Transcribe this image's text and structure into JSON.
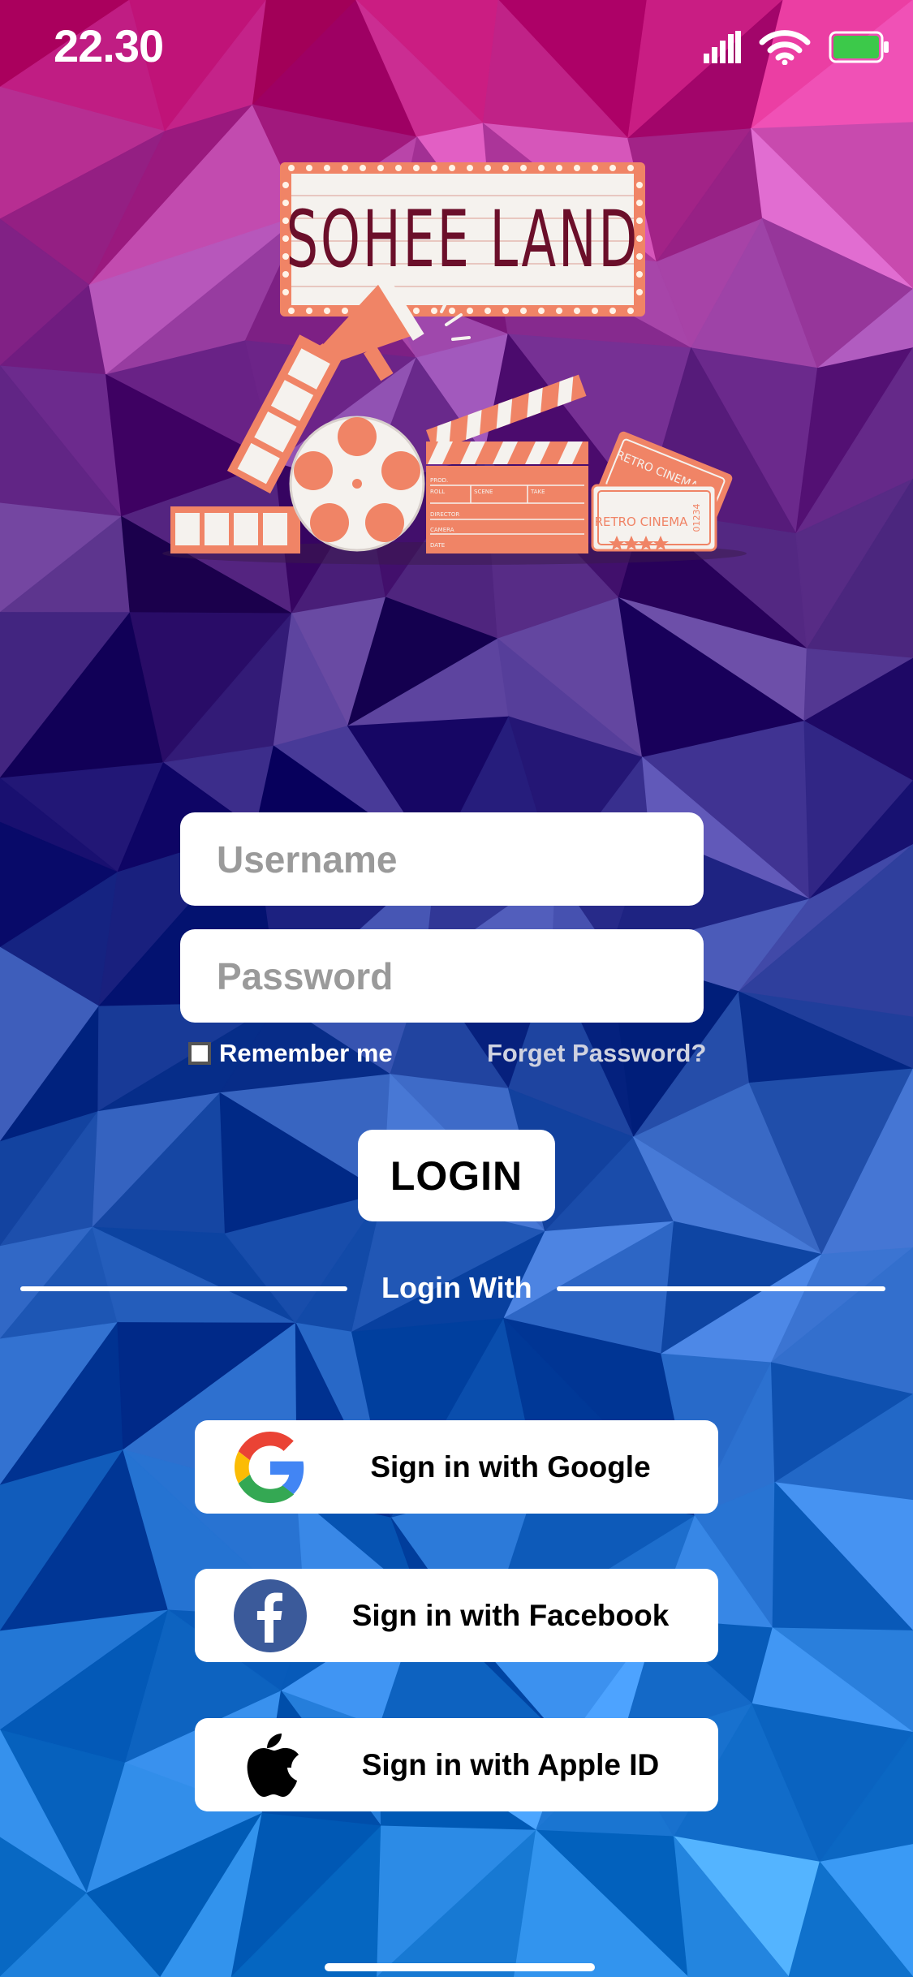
{
  "status_bar": {
    "time": "22.30",
    "icons": [
      "cellular-signal-icon",
      "wifi-icon",
      "battery-icon"
    ],
    "battery_color": "#3cc94a"
  },
  "logo": {
    "marquee_text": "SOHEE LAND",
    "clapper_fields": [
      "PROD.",
      "ROLL",
      "SCENE",
      "TAKE",
      "DIRECTOR",
      "CAMERA",
      "DATE"
    ],
    "ticket_text": "RETRO CINEMA",
    "ticket_number": "01234",
    "ticket_top_text": "RETRO CINEMA",
    "ticket_top_number": "01234",
    "colors": {
      "coral": "#f08466",
      "maroon": "#6b0f2a",
      "cream": "#f5f2ee"
    }
  },
  "form": {
    "username_placeholder": "Username",
    "password_placeholder": "Password",
    "remember_label": "Remember me",
    "forgot_label": "Forget Password?",
    "login_label": "LOGIN",
    "divider_label": "Login With"
  },
  "social": {
    "google": {
      "label": "Sign in with Google",
      "icon": "google-icon"
    },
    "facebook": {
      "label": "Sign in with Facebook",
      "icon": "facebook-icon",
      "color": "#3b5a9a"
    },
    "apple": {
      "label": "Sign in with Apple ID",
      "icon": "apple-icon"
    }
  }
}
